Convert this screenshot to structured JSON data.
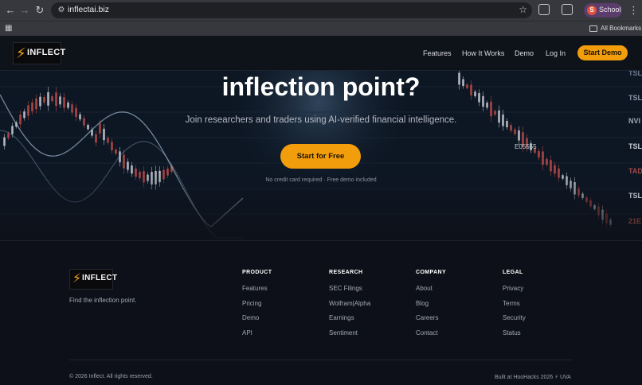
{
  "browser": {
    "url": "inflectai.biz",
    "profile_initial": "S",
    "profile_name": "School",
    "bookmarks_label": "All Bookmarks"
  },
  "header": {
    "logo_text": "INFLECT",
    "nav": [
      "Features",
      "How It Works",
      "Demo",
      "Log In"
    ],
    "cta": "Start Demo"
  },
  "hero": {
    "title": "inflection point?",
    "subtitle": "Join researchers and traders using AI-verified financial intelligence.",
    "cta": "Start for Free",
    "note": "No credit card required · Free demo included",
    "tickers": [
      "TSL",
      "TSL",
      "NVI",
      "TSL",
      "TAD",
      "TSL",
      "21E",
      "E05555"
    ]
  },
  "footer": {
    "logo_text": "INFLECT",
    "tagline": "Find the inflection point.",
    "columns": [
      {
        "heading": "PRODUCT",
        "links": [
          "Features",
          "Pricing",
          "Demo",
          "API"
        ]
      },
      {
        "heading": "RESEARCH",
        "links": [
          "SEC Filings",
          "Wolfram|Alpha",
          "Earnings",
          "Sentiment"
        ]
      },
      {
        "heading": "COMPANY",
        "links": [
          "About",
          "Blog",
          "Careers",
          "Contact"
        ]
      },
      {
        "heading": "LEGAL",
        "links": [
          "Privacy",
          "Terms",
          "Security",
          "Status"
        ]
      }
    ],
    "copyright": "© 2026 Inflect. All rights reserved.",
    "built": "Built at HooHacks 2026 ⚡ UVA"
  },
  "colors": {
    "accent": "#f29d0c",
    "candle_up": "#e4eaf2",
    "candle_down": "#d9534f"
  }
}
